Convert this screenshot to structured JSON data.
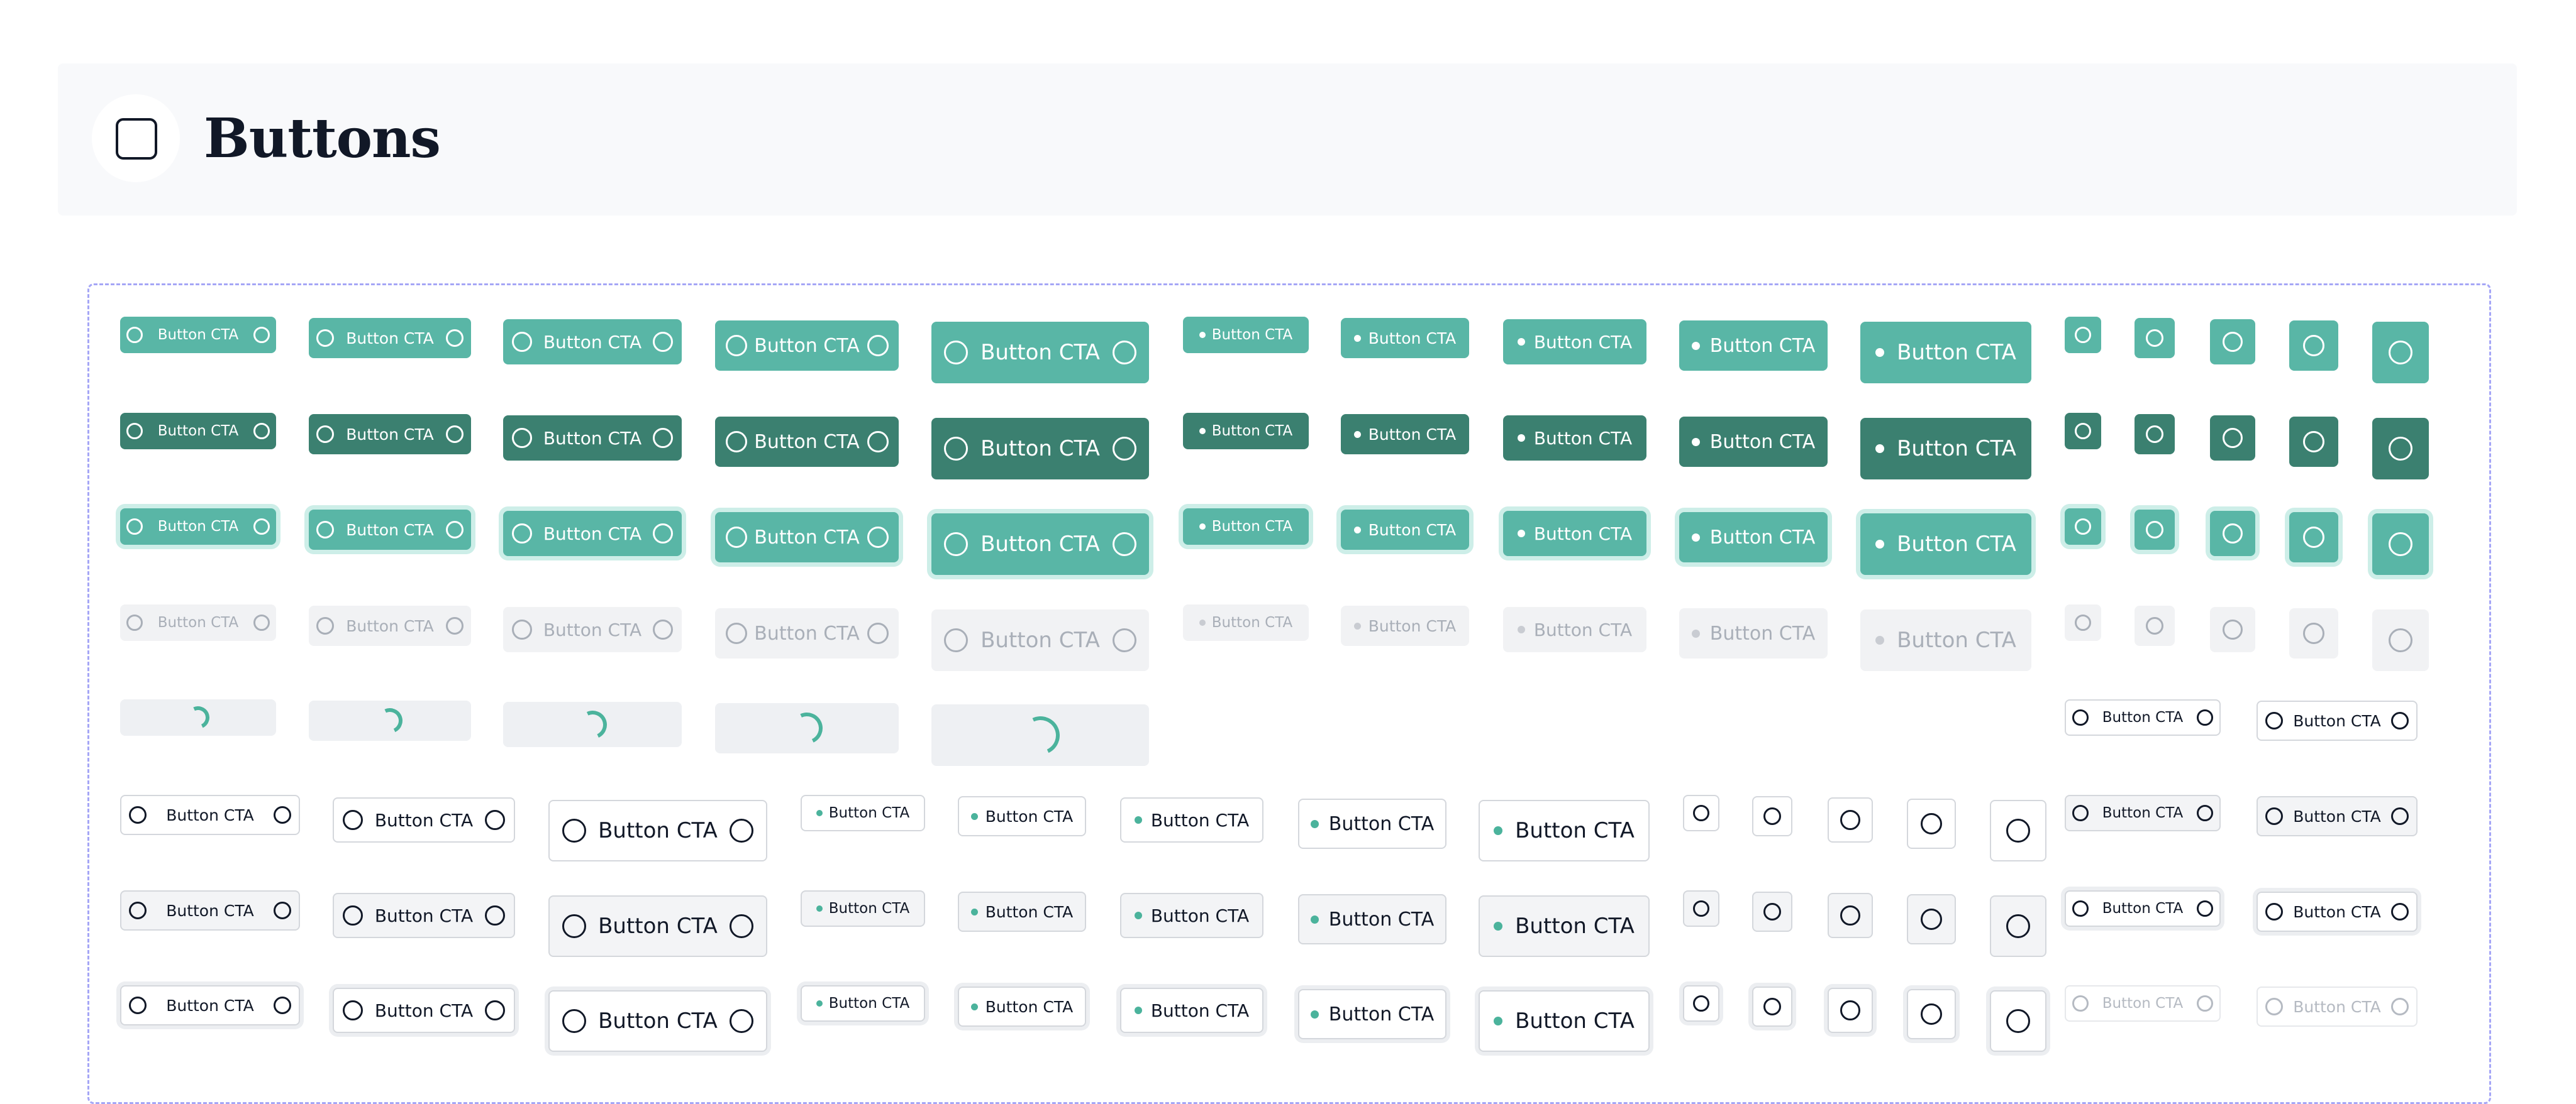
{
  "page": {
    "title": "Buttons",
    "header_icon": "square-icon"
  },
  "labels": {
    "cta": "Button CTA"
  },
  "colors": {
    "primary": "#59b6a6",
    "primary_dark": "#3b8070",
    "focus_ring": "#cdeee8",
    "disabled_bg": "#f1f2f4",
    "disabled_text": "#a9afb8",
    "outline_border": "#d4d7dc",
    "accent_dot": "#4bb39c",
    "frame_border": "#a5a6f6"
  },
  "rows": [
    {
      "state": "primary"
    },
    {
      "state": "primary-hover"
    },
    {
      "state": "primary-focus"
    },
    {
      "state": "primary-disabled"
    },
    {
      "state": "primary-loading"
    },
    {
      "state": "outline"
    },
    {
      "state": "outline-hover"
    },
    {
      "state": "outline-focus"
    }
  ],
  "button_kinds": [
    "icon-left-right",
    "dot-leading",
    "icon-only",
    "loading-spinner"
  ],
  "sizes": [
    "xs",
    "sm",
    "md",
    "lg",
    "xl"
  ]
}
